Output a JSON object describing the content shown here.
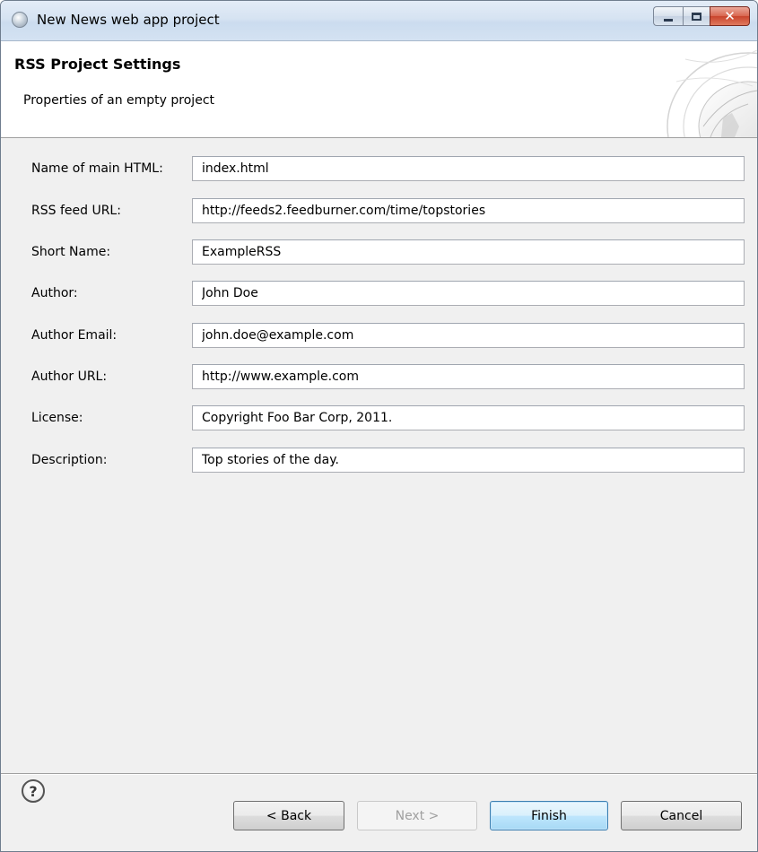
{
  "window": {
    "title": "New News web app project"
  },
  "banner": {
    "title": "RSS Project Settings",
    "description": "Properties of an empty project"
  },
  "form": {
    "fields": [
      {
        "label": "Name of main HTML:",
        "value": "index.html"
      },
      {
        "label": "RSS feed URL:",
        "value": "http://feeds2.feedburner.com/time/topstories"
      },
      {
        "label": "Short Name:",
        "value": "ExampleRSS"
      },
      {
        "label": "Author:",
        "value": "John Doe"
      },
      {
        "label": "Author Email:",
        "value": "john.doe@example.com"
      },
      {
        "label": "Author URL:",
        "value": "http://www.example.com"
      },
      {
        "label": "License:",
        "value": "Copyright Foo Bar Corp, 2011."
      },
      {
        "label": "Description:",
        "value": "Top stories of the day."
      }
    ]
  },
  "buttons": {
    "help": "?",
    "back": "< Back",
    "next": "Next >",
    "finish": "Finish",
    "cancel": "Cancel"
  },
  "state": {
    "next_enabled": false,
    "default_button": "finish"
  },
  "icons": {
    "app": "eclipse-globe-icon",
    "help": "help-icon",
    "banner_graphic": "wizard-globe-graphic"
  },
  "colors": {
    "titlebar": "#d6e3f2",
    "close_button": "#c9442c",
    "dialog_background": "#f0f0f0",
    "default_button_border": "#3c7fb1"
  }
}
